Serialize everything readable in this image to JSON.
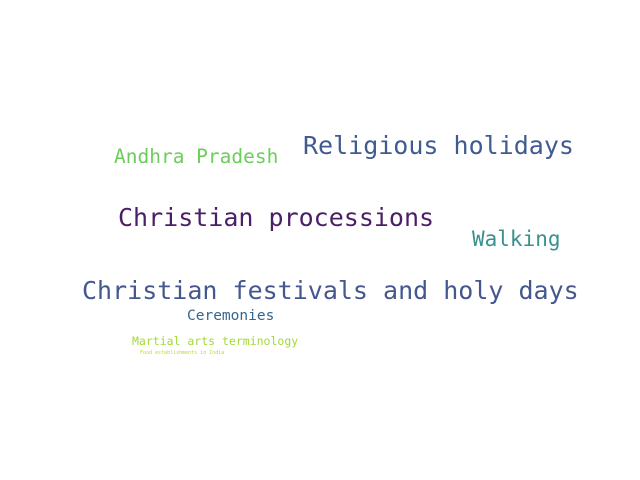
{
  "words": [
    {
      "text": "Religious holidays",
      "color": "#3f5b8f"
    },
    {
      "text": "Andhra Pradesh",
      "color": "#6cce5a"
    },
    {
      "text": "Christian processions",
      "color": "#4b1f66"
    },
    {
      "text": "Walking",
      "color": "#37918c"
    },
    {
      "text": "Christian festivals and holy days",
      "color": "#44578f"
    },
    {
      "text": "Ceremonies",
      "color": "#33658e"
    },
    {
      "text": "Martial arts terminology",
      "color": "#a4d93b"
    },
    {
      "text": "Food establishments in India",
      "color": "#b8de2b"
    }
  ]
}
